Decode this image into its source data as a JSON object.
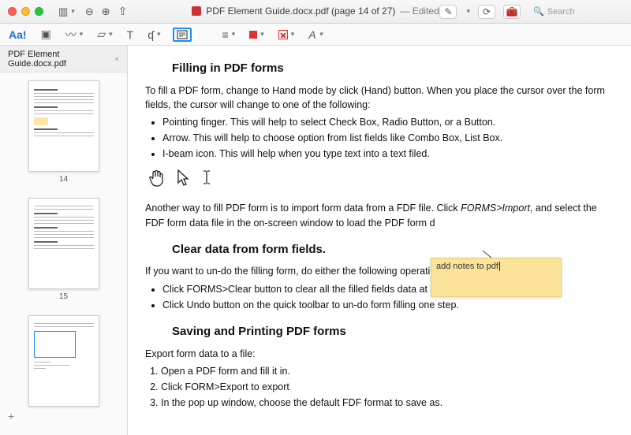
{
  "titlebar": {
    "doc_icon_label": "pdf",
    "title": "PDF Element Guide.docx.pdf (page 14 of 27)",
    "edited": "— Edited",
    "search_placeholder": "Search"
  },
  "toolbar2": {
    "aa": "Aa!",
    "t": "T",
    "a_style": "A",
    "sidebar_dropdown": "▾",
    "zoom_in": "+",
    "zoom_out": "−",
    "note_icon": "▭",
    "line_icon": "≡",
    "share": "⇪",
    "hand_cursor": "☞"
  },
  "sidebar": {
    "tab_label": "PDF Element Guide.docx.pdf",
    "thumbs": [
      {
        "page": "14"
      },
      {
        "page": "15"
      },
      {
        "page": ""
      }
    ],
    "plus": "+"
  },
  "doc": {
    "h1": "Filling in PDF forms",
    "p1": "To fill a PDF form, change to Hand mode by click (Hand) button. When you place the cursor over the form fields, the cursor will change to one of the following:",
    "bullets1": [
      "Pointing finger. This will help to select Check Box, Radio Button, or a Button.",
      "Arrow. This will help to choose option from list fields like Combo Box, List Box.",
      "I-beam icon. This will help when you type text into a text filed."
    ],
    "cursors": {
      "hand": "☝",
      "arrow": "↖",
      "ibeam": "I"
    },
    "p2a": "Another way to fill PDF form is to import form data from a FDF file. Click ",
    "p2i": "FORMS>Import",
    "p2b": ", and select the FDF form data file in the on-screen window to load the PDF form d",
    "note_text": "add notes to pdf",
    "h2": "Clear data from form fields.",
    "p3": "If you want to un-do the filling form, do either the following operation:",
    "bullets2": [
      "Click FORMS>Clear button to clear all the filled fields data at a time.",
      "Click Undo button on the quick toolbar to un-do form filling one step."
    ],
    "h3": "Saving and Printing PDF forms",
    "p4": "Export form data to a file:",
    "steps": [
      "Open a PDF form and fill it in.",
      "Click FORM>Export to export",
      "In the pop up window, choose the default FDF format to save as."
    ]
  }
}
